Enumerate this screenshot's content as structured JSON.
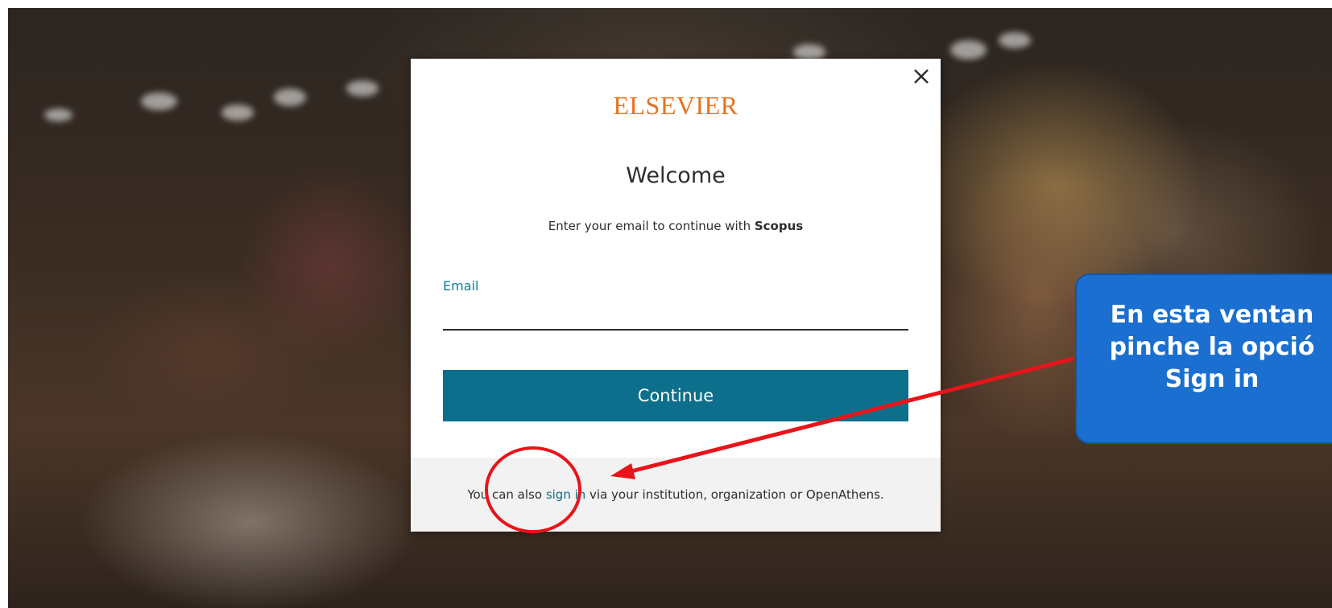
{
  "modal": {
    "brand": "ELSEVIER",
    "title": "Welcome",
    "subtitle_prefix": "Enter your email to continue with ",
    "subtitle_product": "Scopus",
    "email_label": "Email",
    "email_value": "",
    "continue_label": "Continue",
    "footer_prefix": "You can also ",
    "footer_link": "sign in",
    "footer_suffix": " via your institution, organization or OpenAthens.",
    "close_icon": "close-icon"
  },
  "callout": {
    "line1": "En esta ventan",
    "line2": "pinche la opció",
    "line3": "Sign in"
  },
  "annotation": {
    "highlight_color": "#e8141a",
    "arrow_color": "#e8141a",
    "callout_color": "#1a6fd0"
  }
}
